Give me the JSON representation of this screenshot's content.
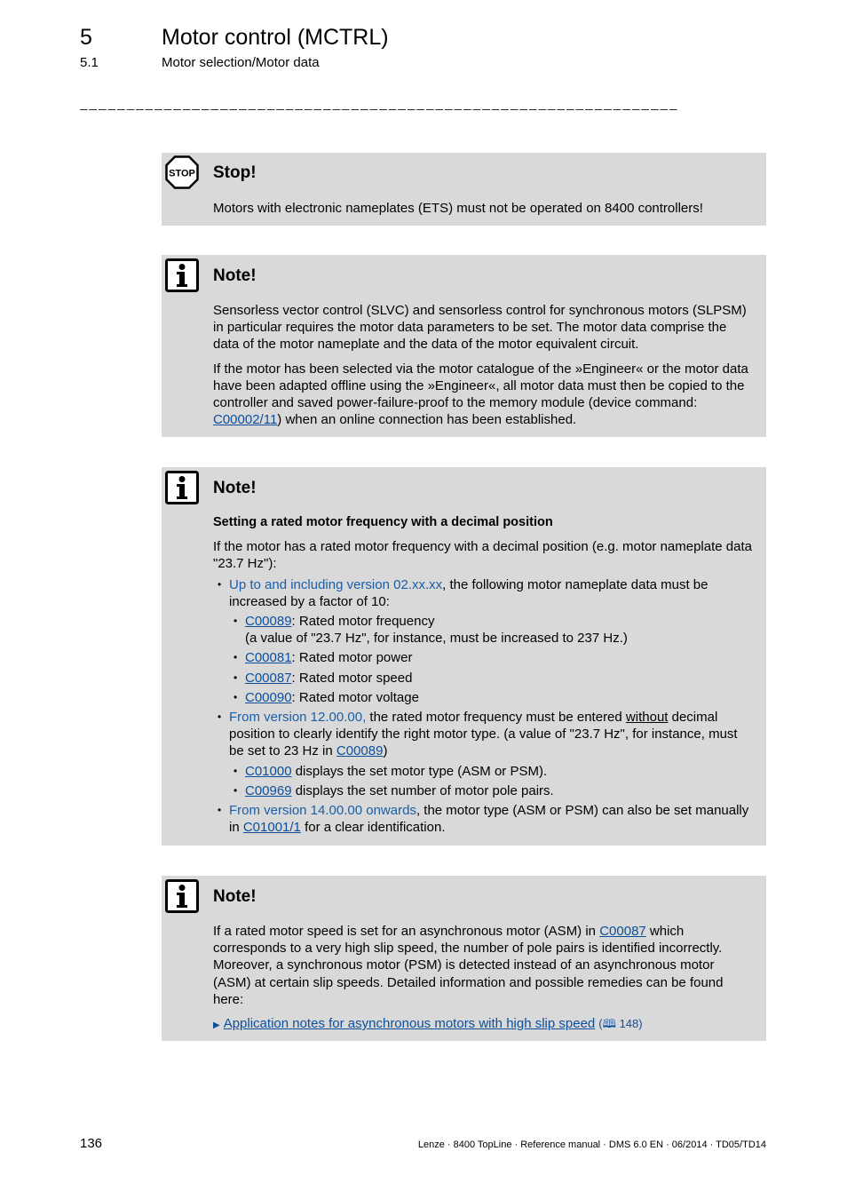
{
  "header": {
    "chapter_number": "5",
    "chapter_title": "Motor control (MCTRL)",
    "section_number": "5.1",
    "section_title": "Motor selection/Motor data",
    "separator": "________________________________________________________________"
  },
  "stop_box": {
    "icon": "stop-sign-icon",
    "icon_text": "STOP",
    "title": "Stop!",
    "text": "Motors with electronic nameplates (ETS) must not be operated on 8400 controllers!"
  },
  "note1": {
    "icon": "info-icon",
    "title": "Note!",
    "para1": "Sensorless vector control (SLVC) and sensorless control for synchronous motors (SLPSM) in particular requires the motor data parameters to be set. The motor data comprise the data of the motor nameplate and the data of the motor equivalent circuit.",
    "para2_before": "If the motor has been selected via the motor catalogue of the »Engineer« or the motor data have been adapted offline using the »Engineer«, all motor data must then be copied to the controller and saved power-failure-proof to the memory module (device command: ",
    "para2_link": "C00002/11",
    "para2_after": ") when an online connection has been established."
  },
  "note2": {
    "icon": "info-icon",
    "title": "Note!",
    "subheading": "Setting a rated motor frequency with a decimal position",
    "intro": "If the motor has a rated motor frequency with a decimal position (e.g. motor nameplate data \"23.7 Hz\"):",
    "item1": {
      "highlight": "Up to and including version 02.xx.xx",
      "text": ", the following motor nameplate data must be increased by a factor of 10:",
      "subitems": [
        {
          "link": "C00089",
          "text": ": Rated motor frequency",
          "extra": "(a value of \"23.7 Hz\", for instance, must be increased to 237 Hz.)"
        },
        {
          "link": "C00081",
          "text": ": Rated motor power"
        },
        {
          "link": "C00087",
          "text": ": Rated motor speed"
        },
        {
          "link": "C00090",
          "text": ": Rated motor voltage"
        }
      ]
    },
    "item2": {
      "highlight": "From version 12.00.00,",
      "text_a": " the rated motor frequency must be entered ",
      "underlined": "without",
      "text_b": " decimal position to clearly identify the right motor type. (a value of \"23.7 Hz\", for instance, must be set to 23 Hz in ",
      "link": "C00089",
      "text_c": ")",
      "subitems": [
        {
          "link": "C01000",
          "text": " displays the set motor type (ASM or PSM)."
        },
        {
          "link": "C00969",
          "text": " displays the set number of motor pole pairs."
        }
      ]
    },
    "item3": {
      "highlight": "From version 14.00.00 onwards",
      "text_a": ", the motor type (ASM or PSM) can also be set manually in ",
      "link": "C01001/1",
      "text_b": " for a clear identification."
    }
  },
  "note3": {
    "icon": "info-icon",
    "title": "Note!",
    "text_a": "If a rated motor speed is set for an asynchronous motor (ASM) in ",
    "link": "C00087",
    "text_b": " which corresponds to a very high slip speed, the number of pole pairs is identified incorrectly. Moreover, a synchronous motor (PSM) is detected instead of an asynchronous motor (ASM) at certain slip speeds. Detailed information and possible remedies can be found here:",
    "ref_link": "Application notes for asynchronous motors with high slip speed",
    "ref_page": "148"
  },
  "footer": {
    "page_number": "136",
    "info": "Lenze · 8400 TopLine · Reference manual · DMS 6.0 EN · 06/2014 · TD05/TD14"
  }
}
